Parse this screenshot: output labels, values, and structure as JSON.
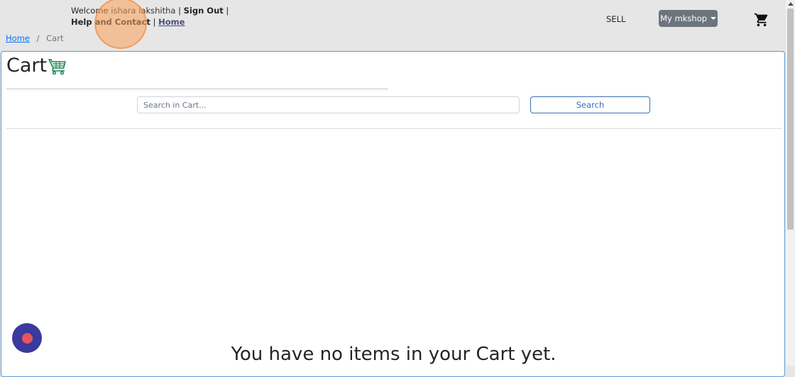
{
  "header": {
    "welcome_prefix": "Welcome",
    "user_name": "ishara lakshitha",
    "sign_out": "Sign Out",
    "help": "Help and Contact",
    "home_link": "Home",
    "sell": "SELL",
    "shop_menu": "My mkshop"
  },
  "breadcrumb": {
    "home": "Home",
    "separator": "/",
    "current": "Cart"
  },
  "cart": {
    "title": "Cart",
    "search_placeholder": "Search in Cart...",
    "search_value": "",
    "search_button": "Search",
    "empty_message": "You have no items in your Cart yet."
  },
  "colors": {
    "accent": "#0d6efd",
    "shop_button": "#6c757d",
    "basket_icon": "#198754",
    "chat_bubble": "#3a3a9e",
    "chat_dot": "#e8545f"
  },
  "icons": [
    "cart-icon",
    "basket-icon",
    "chat-icon",
    "caret-down-icon",
    "scroll-up-icon"
  ]
}
